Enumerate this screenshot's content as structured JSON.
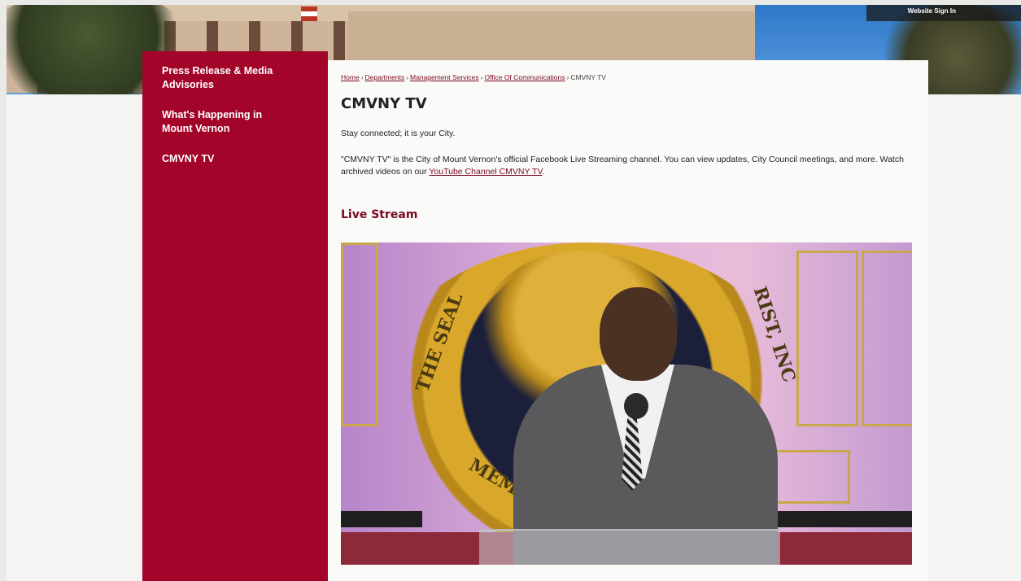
{
  "header": {
    "sign_in": "Website Sign In"
  },
  "sidebar": {
    "items": [
      {
        "label": "Press Release & Media Advisories"
      },
      {
        "label": "What's Happening in Mount Vernon"
      },
      {
        "label": "CMVNY TV"
      }
    ]
  },
  "breadcrumb": {
    "items": [
      "Home",
      "Departments",
      "Management Services",
      "Office Of Communications"
    ],
    "current": "CMVNY TV",
    "separator": "›"
  },
  "page": {
    "title": "CMVNY TV",
    "tagline": "Stay connected; it is your City.",
    "description_before_link": "\"CMVNY TV\" is the City of Mount Vernon's official Facebook Live Streaming channel. You can view updates, City Council meetings, and more. Watch archived videos on our ",
    "description_link": "YouTube Channel CMVNY TV",
    "description_after_link": ".",
    "section_title": "Live Stream"
  },
  "video": {
    "seal_text_left": "THE SEAL",
    "seal_text_right": "RIST, INC",
    "seal_text_bottom": "MEM"
  },
  "colors": {
    "brand": "#a3052a",
    "link": "#7a0a1e"
  }
}
